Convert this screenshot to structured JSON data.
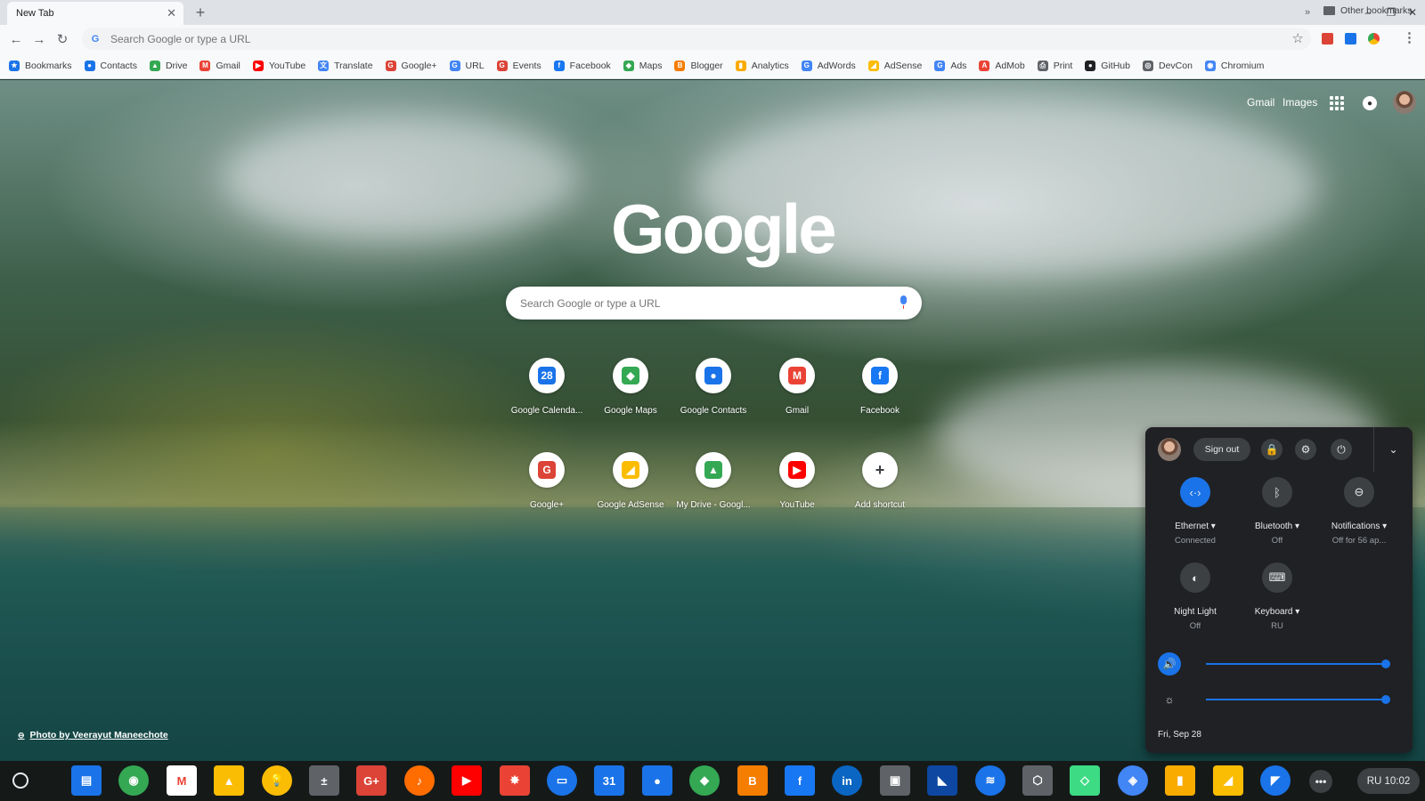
{
  "browser": {
    "tab_title": "New Tab",
    "tab_close": "✕",
    "new_tab": "+",
    "window_controls": {
      "minimize": "–",
      "restore": "❐",
      "close": "✕"
    },
    "nav": {
      "back": "←",
      "forward": "→",
      "reload": "↻"
    },
    "omnibox_placeholder": "Search Google or type a URL",
    "star": "☆",
    "menu": "⋮"
  },
  "bookmarks": [
    {
      "label": "Bookmarks",
      "color": "#1a73e8",
      "glyph": "★"
    },
    {
      "label": "Contacts",
      "color": "#1a73e8",
      "glyph": "●"
    },
    {
      "label": "Drive",
      "color": "#34a853",
      "glyph": "▲"
    },
    {
      "label": "Gmail",
      "color": "#ea4335",
      "glyph": "M"
    },
    {
      "label": "YouTube",
      "color": "#ff0000",
      "glyph": "▶"
    },
    {
      "label": "Translate",
      "color": "#4285f4",
      "glyph": "文"
    },
    {
      "label": "Google+",
      "color": "#db4437",
      "glyph": "G"
    },
    {
      "label": "URL",
      "color": "#4285f4",
      "glyph": "G"
    },
    {
      "label": "Events",
      "color": "#db4437",
      "glyph": "G"
    },
    {
      "label": "Facebook",
      "color": "#1877f2",
      "glyph": "f"
    },
    {
      "label": "Maps",
      "color": "#34a853",
      "glyph": "◆"
    },
    {
      "label": "Blogger",
      "color": "#f57d00",
      "glyph": "B"
    },
    {
      "label": "Analytics",
      "color": "#f9ab00",
      "glyph": "▮"
    },
    {
      "label": "AdWords",
      "color": "#4285f4",
      "glyph": "G"
    },
    {
      "label": "AdSense",
      "color": "#fbbc04",
      "glyph": "◢"
    },
    {
      "label": "Ads",
      "color": "#4285f4",
      "glyph": "G"
    },
    {
      "label": "AdMob",
      "color": "#ea4335",
      "glyph": "A"
    },
    {
      "label": "Print",
      "color": "#5f6368",
      "glyph": "⎙"
    },
    {
      "label": "GitHub",
      "color": "#202124",
      "glyph": "●"
    },
    {
      "label": "DevCon",
      "color": "#5f6368",
      "glyph": "◎"
    },
    {
      "label": "Chromium",
      "color": "#4285f4",
      "glyph": "◉"
    }
  ],
  "bookmarks_more": "»",
  "other_bookmarks": "Other bookmarks",
  "ntp": {
    "gmail_link": "Gmail",
    "images_link": "Images",
    "logo": "Google",
    "search_placeholder": "Search Google or type a URL",
    "photo_credit": "Photo by Veerayut Maneechote",
    "link_glyph": "⊖"
  },
  "shortcuts": [
    {
      "label": "Google Calenda...",
      "color": "#1a73e8",
      "glyph": "28"
    },
    {
      "label": "Google Maps",
      "color": "#34a853",
      "glyph": "◆"
    },
    {
      "label": "Google Contacts",
      "color": "#1a73e8",
      "glyph": "●"
    },
    {
      "label": "Gmail",
      "color": "#ea4335",
      "glyph": "M"
    },
    {
      "label": "Facebook",
      "color": "#1877f2",
      "glyph": "f"
    },
    {
      "label": "Google+",
      "color": "#db4437",
      "glyph": "G"
    },
    {
      "label": "Google AdSense",
      "color": "#fbbc04",
      "glyph": "◢"
    },
    {
      "label": "My Drive - Googl...",
      "color": "#34a853",
      "glyph": "▲"
    },
    {
      "label": "YouTube",
      "color": "#ff0000",
      "glyph": "▶"
    },
    {
      "label": "Add shortcut",
      "color": "#ffffff",
      "glyph": "+"
    }
  ],
  "tray": {
    "sign_out": "Sign out",
    "lock_glyph": "🔒",
    "settings_glyph": "⚙",
    "power_glyph": "⏻",
    "collapse_glyph": "⌄",
    "features": [
      {
        "label": "Ethernet ▾",
        "sub": "Connected",
        "glyph": "‹·›",
        "on": true
      },
      {
        "label": "Bluetooth ▾",
        "sub": "Off",
        "glyph": "ᛒ",
        "on": false
      },
      {
        "label": "Notifications ▾",
        "sub": "Off for 56 ap...",
        "glyph": "⊖",
        "on": false
      },
      {
        "label": "Night Light",
        "sub": "Off",
        "glyph": "◐",
        "on": false
      },
      {
        "label": "Keyboard ▾",
        "sub": "RU",
        "glyph": "⌨",
        "on": false
      }
    ],
    "volume_glyph": "🔊",
    "volume_level": 1.0,
    "brightness_glyph": "☼",
    "brightness_level": 1.0,
    "date": "Fri, Sep 28"
  },
  "shelf": {
    "apps": [
      {
        "name": "files",
        "color": "#1a73e8",
        "glyph": "▤"
      },
      {
        "name": "chrome",
        "color": "#34a853",
        "glyph": "◉"
      },
      {
        "name": "gmail",
        "color": "#ffffff",
        "glyph": "M"
      },
      {
        "name": "drive",
        "color": "#fbbc04",
        "glyph": "▲"
      },
      {
        "name": "keep",
        "color": "#fbbc04",
        "glyph": "💡"
      },
      {
        "name": "calculator",
        "color": "#5f6368",
        "glyph": "±"
      },
      {
        "name": "google-plus",
        "color": "#db4437",
        "glyph": "G+"
      },
      {
        "name": "play-music",
        "color": "#ff6d00",
        "glyph": "♪"
      },
      {
        "name": "youtube",
        "color": "#ff0000",
        "glyph": "▶"
      },
      {
        "name": "photos",
        "color": "#ea4335",
        "glyph": "✸"
      },
      {
        "name": "messages",
        "color": "#1a73e8",
        "glyph": "▭"
      },
      {
        "name": "calendar",
        "color": "#1a73e8",
        "glyph": "31"
      },
      {
        "name": "contacts",
        "color": "#1a73e8",
        "glyph": "●"
      },
      {
        "name": "maps",
        "color": "#34a853",
        "glyph": "◆"
      },
      {
        "name": "blogger",
        "color": "#f57d00",
        "glyph": "B"
      },
      {
        "name": "facebook",
        "color": "#1877f2",
        "glyph": "f"
      },
      {
        "name": "linkedin",
        "color": "#0a66c2",
        "glyph": "in"
      },
      {
        "name": "remote-desktop",
        "color": "#5f6368",
        "glyph": "▣"
      },
      {
        "name": "bird-app",
        "color": "#0d47a1",
        "glyph": "◣"
      },
      {
        "name": "wave-app",
        "color": "#1a73e8",
        "glyph": "≋"
      },
      {
        "name": "hex-app",
        "color": "#5f6368",
        "glyph": "⬡"
      },
      {
        "name": "android-studio",
        "color": "#3ddc84",
        "glyph": "◇"
      },
      {
        "name": "chrome-dev",
        "color": "#4285f4",
        "glyph": "◈"
      },
      {
        "name": "analytics",
        "color": "#f9ab00",
        "glyph": "▮"
      },
      {
        "name": "adsense",
        "color": "#fbbc04",
        "glyph": "◢"
      },
      {
        "name": "docs-app",
        "color": "#1a73e8",
        "glyph": "◤"
      }
    ],
    "more": "•••",
    "status": "RU 10:02"
  }
}
